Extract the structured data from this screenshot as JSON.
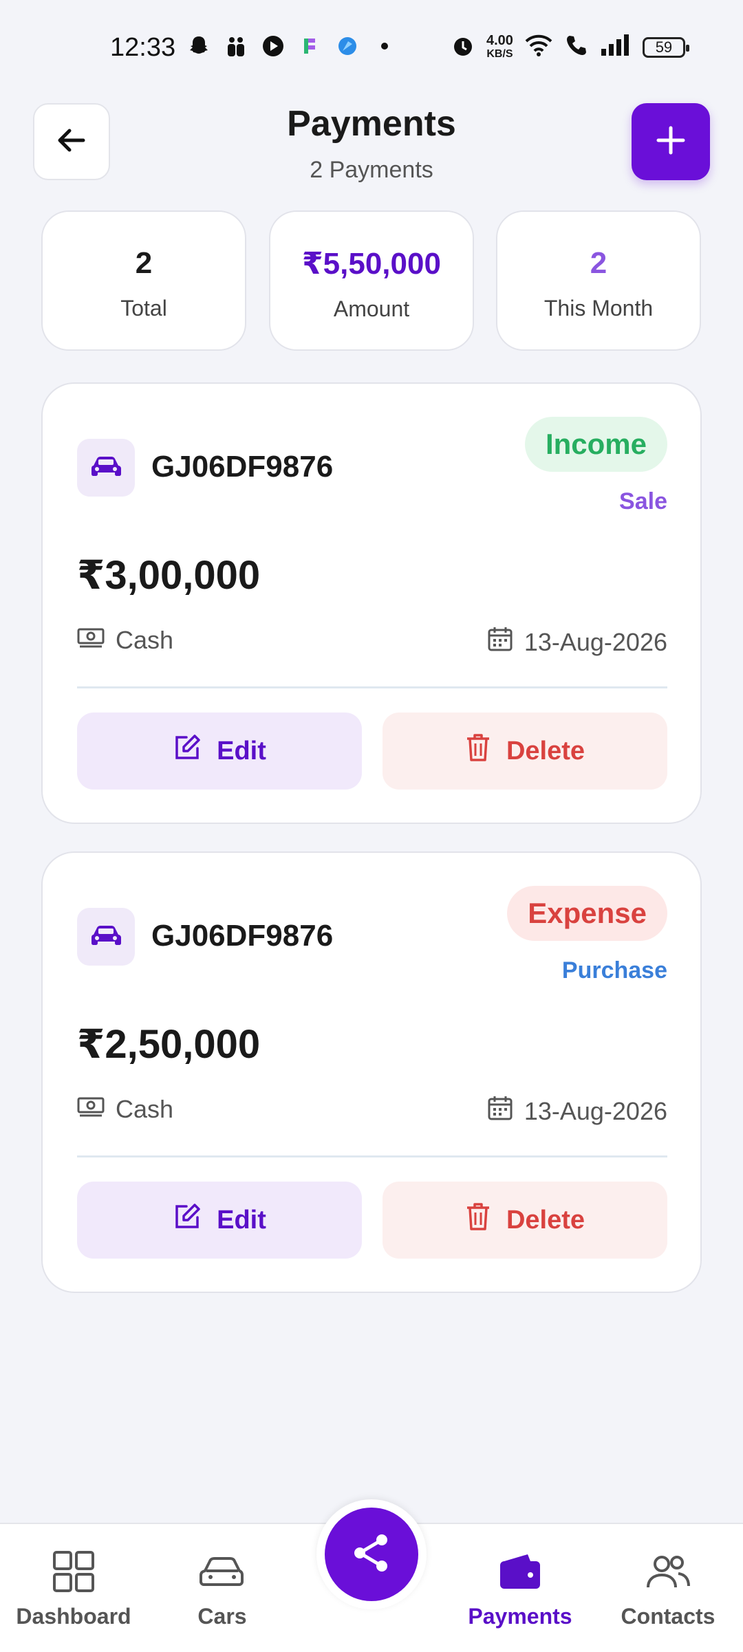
{
  "status_bar": {
    "time": "12:33",
    "speed_value": "4.00",
    "speed_unit": "KB/S",
    "battery": "59"
  },
  "header": {
    "title": "Payments",
    "subtitle": "2 Payments",
    "back_icon": "arrow-left-icon",
    "add_icon": "plus-icon"
  },
  "stats": [
    {
      "value": "2",
      "label": "Total",
      "color": "#1a1a1a"
    },
    {
      "value": "₹5,50,000",
      "label": "Amount",
      "color": "#5a0fc8"
    },
    {
      "value": "2",
      "label": "This Month",
      "color": "#8a55e0"
    }
  ],
  "payments": [
    {
      "vehicle": "GJ06DF9876",
      "type": "Income",
      "type_color": "#27ae60",
      "type_bg": "#e4f7ea",
      "sub_type": "Sale",
      "sub_type_color": "#8a55e0",
      "amount": "₹3,00,000",
      "method": "Cash",
      "date": "13-Aug-2026",
      "edit_label": "Edit",
      "delete_label": "Delete"
    },
    {
      "vehicle": "GJ06DF9876",
      "type": "Expense",
      "type_color": "#d9423f",
      "type_bg": "#fde8e7",
      "sub_type": "Purchase",
      "sub_type_color": "#3a7fd9",
      "amount": "₹2,50,000",
      "method": "Cash",
      "date": "13-Aug-2026",
      "edit_label": "Edit",
      "delete_label": "Delete"
    }
  ],
  "bottom_nav": {
    "items": [
      {
        "label": "Dashboard",
        "icon": "grid-icon",
        "active": false
      },
      {
        "label": "Cars",
        "icon": "car-icon",
        "active": false
      },
      {
        "label": "Payments",
        "icon": "wallet-icon",
        "active": true
      },
      {
        "label": "Contacts",
        "icon": "users-icon",
        "active": false
      }
    ],
    "fab_icon": "share-icon",
    "active_color": "#5a0fc8"
  }
}
